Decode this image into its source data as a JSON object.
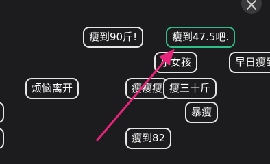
{
  "tags": [
    {
      "id": "tag-90",
      "label": "瘦到90斤!"
    },
    {
      "id": "tag-47",
      "label": "瘦到47.5吧."
    },
    {
      "id": "tag-girl",
      "label": "小女孩"
    },
    {
      "id": "tag-early",
      "label": "早日瘦到"
    },
    {
      "id": "tag-worry",
      "label": "烦恼离开"
    },
    {
      "id": "tag-thin3",
      "label": "瘦瘦瘦"
    },
    {
      "id": "tag-30",
      "label": "瘦三十斤"
    },
    {
      "id": "tag-extreme",
      "label": "暴瘦"
    },
    {
      "id": "tag-82",
      "label": "瘦到82"
    }
  ],
  "selected_tag": "瘦到47.5吧.",
  "icons": {
    "close": "close-icon",
    "pointer": "arrow-annotation-icon"
  },
  "colors": {
    "background": "#1c1c1e",
    "chip_border": "#e6e6e6",
    "selected_border": "#2fbf86",
    "arrow": "#e6247a"
  }
}
